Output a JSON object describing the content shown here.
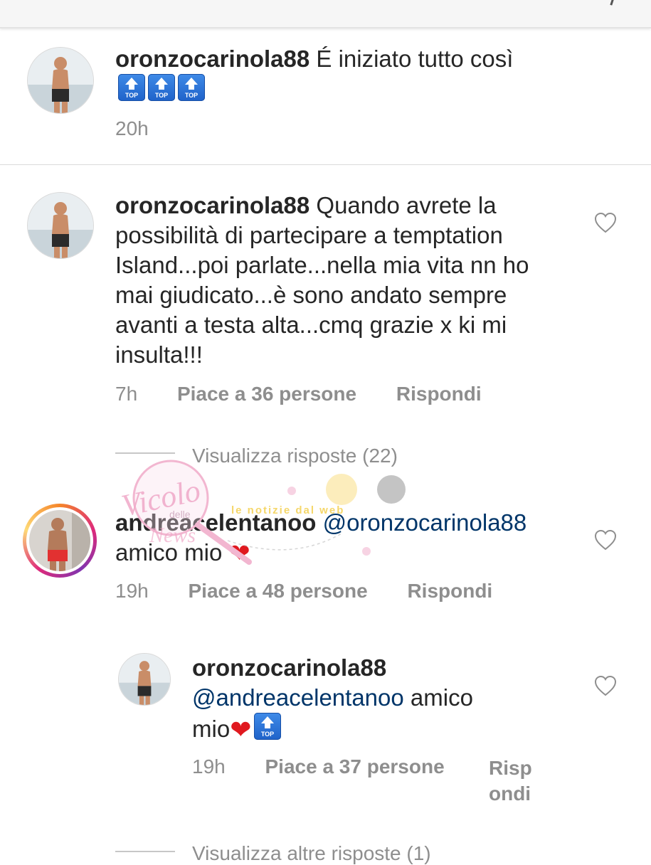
{
  "comments": [
    {
      "username": "oronzocarinola88",
      "text": "É iniziato tutto così",
      "emojis": [
        "top-arrow-emoji",
        "top-arrow-emoji",
        "top-arrow-emoji"
      ],
      "time": "20h"
    },
    {
      "username": "oronzocarinola88",
      "text_lines": [
        "Quando avrete la",
        "possibilità di partecipare a temptation",
        "Island...poi parlate...nella mia vita nn ho",
        "mai giudicato...è sono andato sempre",
        "avanti a testa alta...cmq grazie x ki mi",
        "insulta!!!"
      ],
      "time": "7h",
      "likes": "Piace a 36 persone",
      "reply": "Rispondi",
      "view_replies": "Visualizza risposte (22)"
    },
    {
      "username": "andreacelentanoo",
      "mention": "@oronzocarinola88",
      "text": "amico mio",
      "emoji": "❤",
      "time": "19h",
      "likes": "Piace a 48 persone",
      "reply": "Rispondi"
    },
    {
      "username": "oronzocarinola88",
      "mention": "@andreacelentanoo",
      "text_a": "amico",
      "text_b": "mio",
      "emoji": "❤",
      "time": "19h",
      "likes": "Piace a 37 persone",
      "reply_a": "Risp",
      "reply_b": "ondi"
    }
  ],
  "more_replies": "Visualizza altre risposte (1)",
  "watermark": {
    "script": "Vicolo",
    "small": "delle",
    "script2": "News",
    "banner": "le notizie dal web"
  },
  "colors": {
    "text": "#262626",
    "meta": "#8e8e8e",
    "mention": "#003569",
    "heart": "#e0191f"
  }
}
